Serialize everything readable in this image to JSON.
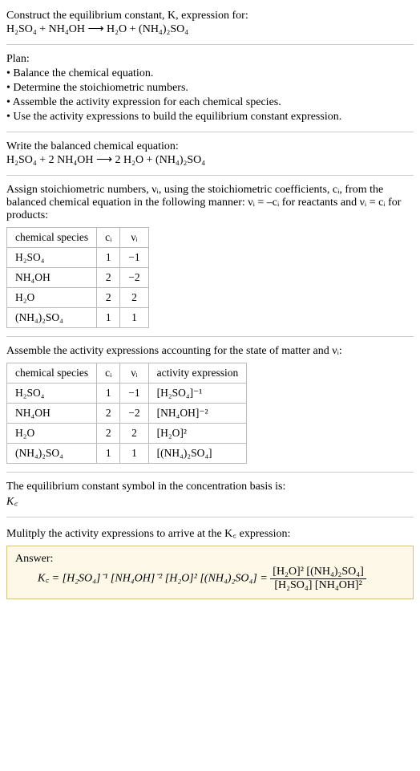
{
  "intro": {
    "line1": "Construct the equilibrium constant, K, expression for:",
    "eq": "H₂SO₄ + NH₄OH ⟶ H₂O + (NH₄)₂SO₄"
  },
  "plan": {
    "heading": "Plan:",
    "b1": "• Balance the chemical equation.",
    "b2": "• Determine the stoichiometric numbers.",
    "b3": "• Assemble the activity expression for each chemical species.",
    "b4": "• Use the activity expressions to build the equilibrium constant expression."
  },
  "balanced": {
    "heading": "Write the balanced chemical equation:",
    "eq": "H₂SO₄ + 2 NH₄OH ⟶ 2 H₂O + (NH₄)₂SO₄"
  },
  "stoich": {
    "text_a": "Assign stoichiometric numbers, νᵢ, using the stoichiometric coefficients, cᵢ, from the balanced chemical equation in the following manner: νᵢ = –cᵢ for reactants and νᵢ = cᵢ for products:",
    "h1": "chemical species",
    "h2": "cᵢ",
    "h3": "νᵢ",
    "r1c1": "H₂SO₄",
    "r1c2": "1",
    "r1c3": "−1",
    "r2c1": "NH₄OH",
    "r2c2": "2",
    "r2c3": "−2",
    "r3c1": "H₂O",
    "r3c2": "2",
    "r3c3": "2",
    "r4c1": "(NH₄)₂SO₄",
    "r4c2": "1",
    "r4c3": "1"
  },
  "activity": {
    "text": "Assemble the activity expressions accounting for the state of matter and νᵢ:",
    "h1": "chemical species",
    "h2": "cᵢ",
    "h3": "νᵢ",
    "h4": "activity expression",
    "r1c1": "H₂SO₄",
    "r1c2": "1",
    "r1c3": "−1",
    "r1c4": "[H₂SO₄]⁻¹",
    "r2c1": "NH₄OH",
    "r2c2": "2",
    "r2c3": "−2",
    "r2c4": "[NH₄OH]⁻²",
    "r3c1": "H₂O",
    "r3c2": "2",
    "r3c3": "2",
    "r3c4": "[H₂O]²",
    "r4c1": "(NH₄)₂SO₄",
    "r4c2": "1",
    "r4c3": "1",
    "r4c4": "[(NH₄)₂SO₄]"
  },
  "symbol": {
    "text": "The equilibrium constant symbol in the concentration basis is:",
    "val": "K꜀"
  },
  "final": {
    "text": "Mulitply the activity expressions to arrive at the K꜀ expression:",
    "answer_label": "Answer:",
    "lhs": "K꜀ = [H₂SO₄]⁻¹ [NH₄OH]⁻² [H₂O]² [(NH₄)₂SO₄] = ",
    "num": "[H₂O]² [(NH₄)₂SO₄]",
    "den": "[H₂SO₄] [NH₄OH]²"
  }
}
